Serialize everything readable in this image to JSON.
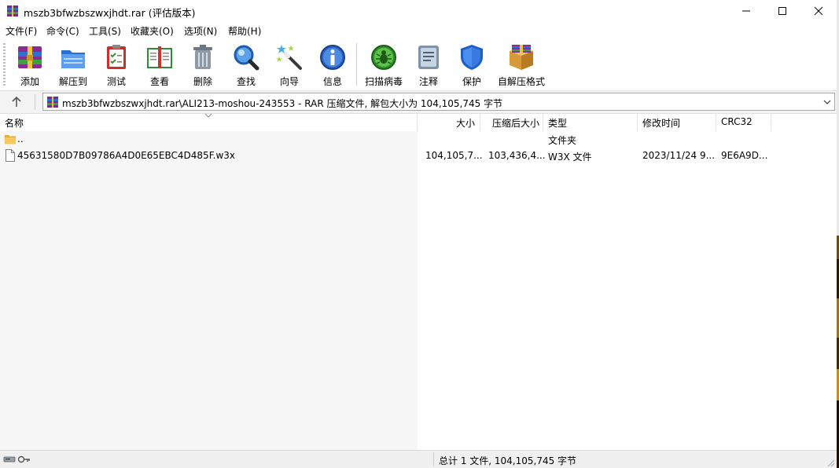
{
  "window": {
    "title": "mszb3bfwzbszwxjhdt.rar (评估版本)"
  },
  "menu": [
    {
      "label": "文件(F)"
    },
    {
      "label": "命令(C)"
    },
    {
      "label": "工具(S)"
    },
    {
      "label": "收藏夹(O)"
    },
    {
      "label": "选项(N)"
    },
    {
      "label": "帮助(H)"
    }
  ],
  "toolbar": [
    {
      "label": "添加",
      "icon": "add-archive-icon"
    },
    {
      "label": "解压到",
      "icon": "extract-folder-icon"
    },
    {
      "label": "测试",
      "icon": "test-clipboard-icon"
    },
    {
      "label": "查看",
      "icon": "view-book-icon"
    },
    {
      "label": "删除",
      "icon": "trash-can-icon"
    },
    {
      "label": "查找",
      "icon": "magnifier-icon"
    },
    {
      "label": "向导",
      "icon": "magic-wand-icon"
    },
    {
      "label": "信息",
      "icon": "info-icon"
    },
    {
      "label": "扫描病毒",
      "icon": "virus-scan-icon"
    },
    {
      "label": "注释",
      "icon": "comment-icon"
    },
    {
      "label": "保护",
      "icon": "shield-icon"
    },
    {
      "label": "自解压格式",
      "icon": "sfx-box-icon"
    }
  ],
  "address": {
    "path": "mszb3bfwzbszwxjhdt.rar\\ALI213-moshou-243553 - RAR 压缩文件, 解包大小为 104,105,745 字节"
  },
  "columns": {
    "name": "名称",
    "size": "大小",
    "packed": "压缩后大小",
    "type": "类型",
    "modified": "修改时间",
    "crc": "CRC32"
  },
  "rows": [
    {
      "name": "..",
      "size": "",
      "packed": "",
      "type": "文件夹",
      "modified": "",
      "crc": ""
    },
    {
      "name": "45631580D7B09786A4D0E65EBC4D485F.w3x",
      "size": "104,105,7...",
      "packed": "103,436,4...",
      "type": "W3X 文件",
      "modified": "2023/11/24 9...",
      "crc": "9E6A9D..."
    }
  ],
  "status": {
    "summary": "总计 1 文件, 104,105,745 字节"
  },
  "colors": {
    "folder": "#f2c15a",
    "accent_blue": "#1a6fd1",
    "shield_blue": "#2a74e0",
    "virus_green": "#3aa82a"
  }
}
